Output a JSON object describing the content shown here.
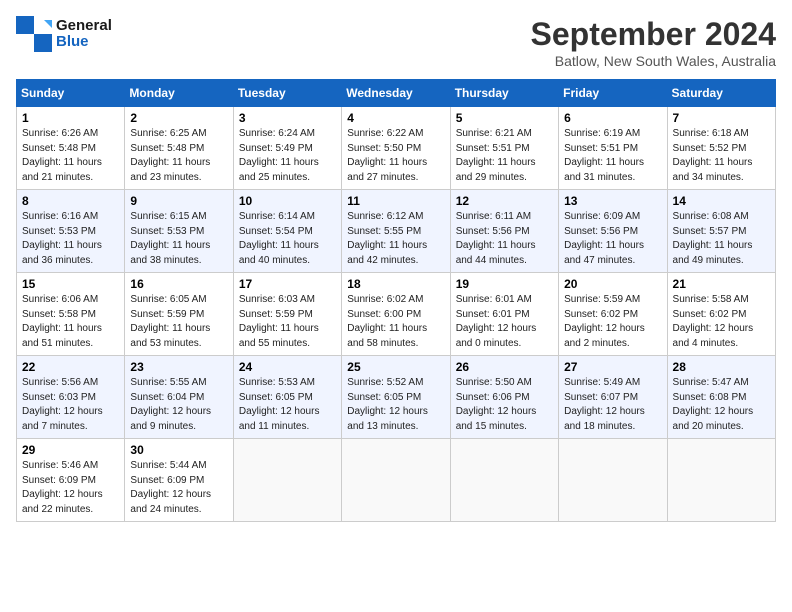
{
  "header": {
    "logo_line1": "General",
    "logo_line2": "Blue",
    "month": "September 2024",
    "location": "Batlow, New South Wales, Australia"
  },
  "weekdays": [
    "Sunday",
    "Monday",
    "Tuesday",
    "Wednesday",
    "Thursday",
    "Friday",
    "Saturday"
  ],
  "weeks": [
    [
      {
        "day": "1",
        "sunrise": "6:26 AM",
        "sunset": "5:48 PM",
        "daylight": "11 hours and 21 minutes."
      },
      {
        "day": "2",
        "sunrise": "6:25 AM",
        "sunset": "5:48 PM",
        "daylight": "11 hours and 23 minutes."
      },
      {
        "day": "3",
        "sunrise": "6:24 AM",
        "sunset": "5:49 PM",
        "daylight": "11 hours and 25 minutes."
      },
      {
        "day": "4",
        "sunrise": "6:22 AM",
        "sunset": "5:50 PM",
        "daylight": "11 hours and 27 minutes."
      },
      {
        "day": "5",
        "sunrise": "6:21 AM",
        "sunset": "5:51 PM",
        "daylight": "11 hours and 29 minutes."
      },
      {
        "day": "6",
        "sunrise": "6:19 AM",
        "sunset": "5:51 PM",
        "daylight": "11 hours and 31 minutes."
      },
      {
        "day": "7",
        "sunrise": "6:18 AM",
        "sunset": "5:52 PM",
        "daylight": "11 hours and 34 minutes."
      }
    ],
    [
      {
        "day": "8",
        "sunrise": "6:16 AM",
        "sunset": "5:53 PM",
        "daylight": "11 hours and 36 minutes."
      },
      {
        "day": "9",
        "sunrise": "6:15 AM",
        "sunset": "5:53 PM",
        "daylight": "11 hours and 38 minutes."
      },
      {
        "day": "10",
        "sunrise": "6:14 AM",
        "sunset": "5:54 PM",
        "daylight": "11 hours and 40 minutes."
      },
      {
        "day": "11",
        "sunrise": "6:12 AM",
        "sunset": "5:55 PM",
        "daylight": "11 hours and 42 minutes."
      },
      {
        "day": "12",
        "sunrise": "6:11 AM",
        "sunset": "5:56 PM",
        "daylight": "11 hours and 44 minutes."
      },
      {
        "day": "13",
        "sunrise": "6:09 AM",
        "sunset": "5:56 PM",
        "daylight": "11 hours and 47 minutes."
      },
      {
        "day": "14",
        "sunrise": "6:08 AM",
        "sunset": "5:57 PM",
        "daylight": "11 hours and 49 minutes."
      }
    ],
    [
      {
        "day": "15",
        "sunrise": "6:06 AM",
        "sunset": "5:58 PM",
        "daylight": "11 hours and 51 minutes."
      },
      {
        "day": "16",
        "sunrise": "6:05 AM",
        "sunset": "5:59 PM",
        "daylight": "11 hours and 53 minutes."
      },
      {
        "day": "17",
        "sunrise": "6:03 AM",
        "sunset": "5:59 PM",
        "daylight": "11 hours and 55 minutes."
      },
      {
        "day": "18",
        "sunrise": "6:02 AM",
        "sunset": "6:00 PM",
        "daylight": "11 hours and 58 minutes."
      },
      {
        "day": "19",
        "sunrise": "6:01 AM",
        "sunset": "6:01 PM",
        "daylight": "12 hours and 0 minutes."
      },
      {
        "day": "20",
        "sunrise": "5:59 AM",
        "sunset": "6:02 PM",
        "daylight": "12 hours and 2 minutes."
      },
      {
        "day": "21",
        "sunrise": "5:58 AM",
        "sunset": "6:02 PM",
        "daylight": "12 hours and 4 minutes."
      }
    ],
    [
      {
        "day": "22",
        "sunrise": "5:56 AM",
        "sunset": "6:03 PM",
        "daylight": "12 hours and 7 minutes."
      },
      {
        "day": "23",
        "sunrise": "5:55 AM",
        "sunset": "6:04 PM",
        "daylight": "12 hours and 9 minutes."
      },
      {
        "day": "24",
        "sunrise": "5:53 AM",
        "sunset": "6:05 PM",
        "daylight": "12 hours and 11 minutes."
      },
      {
        "day": "25",
        "sunrise": "5:52 AM",
        "sunset": "6:05 PM",
        "daylight": "12 hours and 13 minutes."
      },
      {
        "day": "26",
        "sunrise": "5:50 AM",
        "sunset": "6:06 PM",
        "daylight": "12 hours and 15 minutes."
      },
      {
        "day": "27",
        "sunrise": "5:49 AM",
        "sunset": "6:07 PM",
        "daylight": "12 hours and 18 minutes."
      },
      {
        "day": "28",
        "sunrise": "5:47 AM",
        "sunset": "6:08 PM",
        "daylight": "12 hours and 20 minutes."
      }
    ],
    [
      {
        "day": "29",
        "sunrise": "5:46 AM",
        "sunset": "6:09 PM",
        "daylight": "12 hours and 22 minutes."
      },
      {
        "day": "30",
        "sunrise": "5:44 AM",
        "sunset": "6:09 PM",
        "daylight": "12 hours and 24 minutes."
      },
      null,
      null,
      null,
      null,
      null
    ]
  ]
}
